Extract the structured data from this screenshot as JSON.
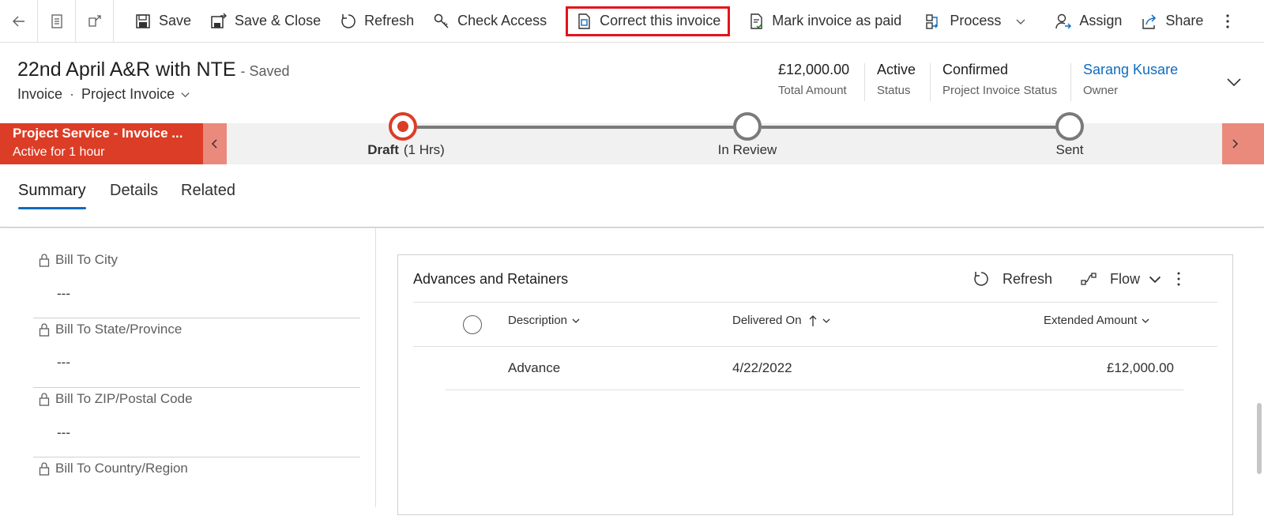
{
  "commandbar": {
    "save": "Save",
    "save_close": "Save & Close",
    "refresh": "Refresh",
    "check_access": "Check Access",
    "correct_invoice": "Correct this invoice",
    "mark_paid": "Mark invoice as paid",
    "process": "Process",
    "assign": "Assign",
    "share": "Share"
  },
  "header": {
    "title": "22nd April A&R with NTE",
    "save_state": "- Saved",
    "entity": "Invoice",
    "form": "Project Invoice",
    "fields": [
      {
        "value": "£12,000.00",
        "label": "Total Amount"
      },
      {
        "value": "Active",
        "label": "Status"
      },
      {
        "value": "Confirmed",
        "label": "Project Invoice Status"
      },
      {
        "value": "Sarang Kusare",
        "label": "Owner"
      }
    ]
  },
  "bpf": {
    "process_name": "Project Service - Invoice ...",
    "active_for": "Active for 1 hour",
    "stages": [
      {
        "name": "Draft",
        "duration": "(1 Hrs)"
      },
      {
        "name": "In Review",
        "duration": ""
      },
      {
        "name": "Sent",
        "duration": ""
      }
    ]
  },
  "tabs": [
    "Summary",
    "Details",
    "Related"
  ],
  "fields": [
    {
      "label": "Bill To City",
      "value": "---"
    },
    {
      "label": "Bill To State/Province",
      "value": "---"
    },
    {
      "label": "Bill To ZIP/Postal Code",
      "value": "---"
    },
    {
      "label": "Bill To Country/Region",
      "value": ""
    }
  ],
  "grid": {
    "title": "Advances and Retainers",
    "refresh": "Refresh",
    "flow": "Flow",
    "columns": [
      "Description",
      "Delivered On",
      "Extended Amount"
    ],
    "rows": [
      {
        "description": "Advance",
        "delivered_on": "4/22/2022",
        "extended_amount": "£12,000.00"
      }
    ]
  },
  "colors": {
    "accent": "#0f6cbd",
    "bpf_active": "#dc3d26",
    "highlight": "#e3141b"
  }
}
